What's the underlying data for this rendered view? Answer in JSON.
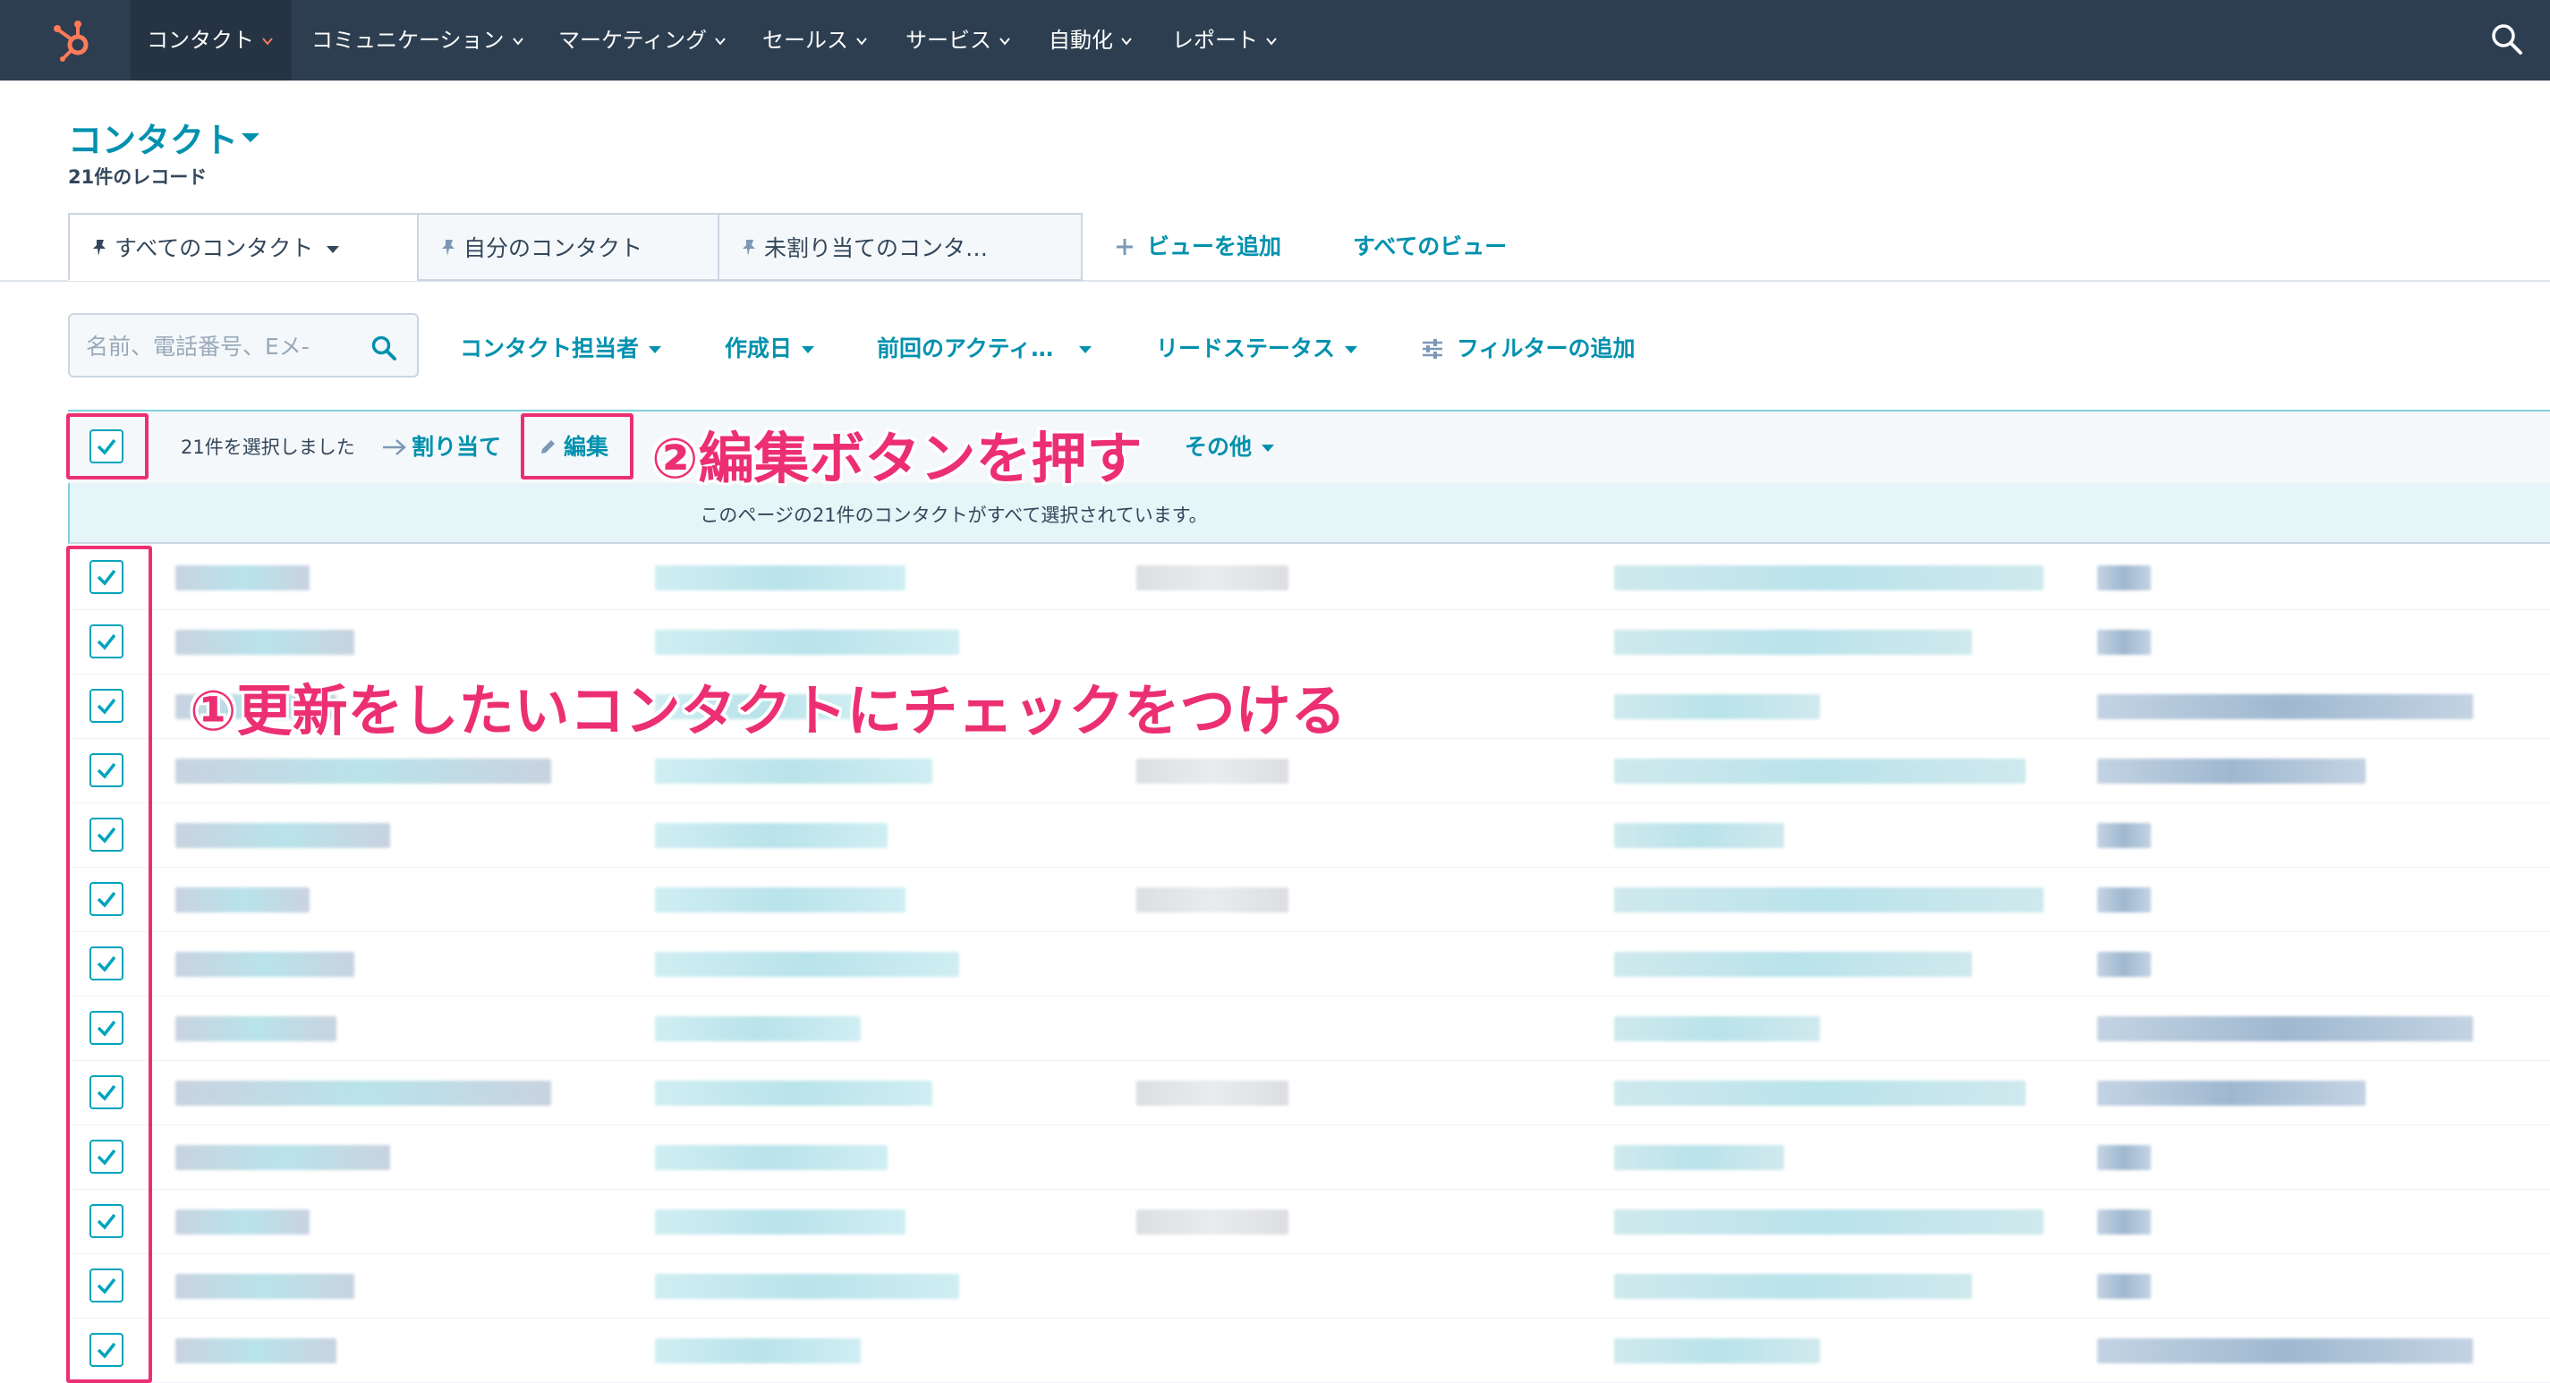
{
  "nav": {
    "items": [
      {
        "label": "コンタクト",
        "active": true
      },
      {
        "label": "コミュニケーション",
        "active": false
      },
      {
        "label": "マーケティング",
        "active": false
      },
      {
        "label": "セールス",
        "active": false
      },
      {
        "label": "サービス",
        "active": false
      },
      {
        "label": "自動化",
        "active": false
      },
      {
        "label": "レポート",
        "active": false
      }
    ]
  },
  "header": {
    "title": "コンタクト",
    "record_count": "21件のレコード"
  },
  "tabs": {
    "items": [
      {
        "label": "すべてのコンタクト"
      },
      {
        "label": "自分のコンタクト"
      },
      {
        "label": "未割り当てのコンタ…"
      }
    ],
    "add_view": "ビューを追加",
    "all_views": "すべてのビュー"
  },
  "filters": {
    "search_placeholder": "名前、電話番号、Eメ-",
    "owner": "コンタクト担当者",
    "created": "作成日",
    "last_activity": "前回のアクティ…",
    "lead_status": "リードステータス",
    "add_filter": "フィルターの追加"
  },
  "bulk": {
    "selected_count": "21件を選択しました",
    "assign": "割り当て",
    "edit": "編集",
    "more": "その他",
    "banner": "このページの21件のコンタクトがすべて選択されています。"
  },
  "annotations": {
    "step1": "①更新をしたいコンタクトにチェックをつける",
    "step2": "②編集ボタンを押す"
  },
  "colors": {
    "nav_bg": "#2d3e50",
    "accent": "#0091ae",
    "checkbox": "#00a4bd",
    "annotation": "#ec2f72",
    "logo": "#ff7a59"
  },
  "table": {
    "visible_checked_rows": 13
  }
}
